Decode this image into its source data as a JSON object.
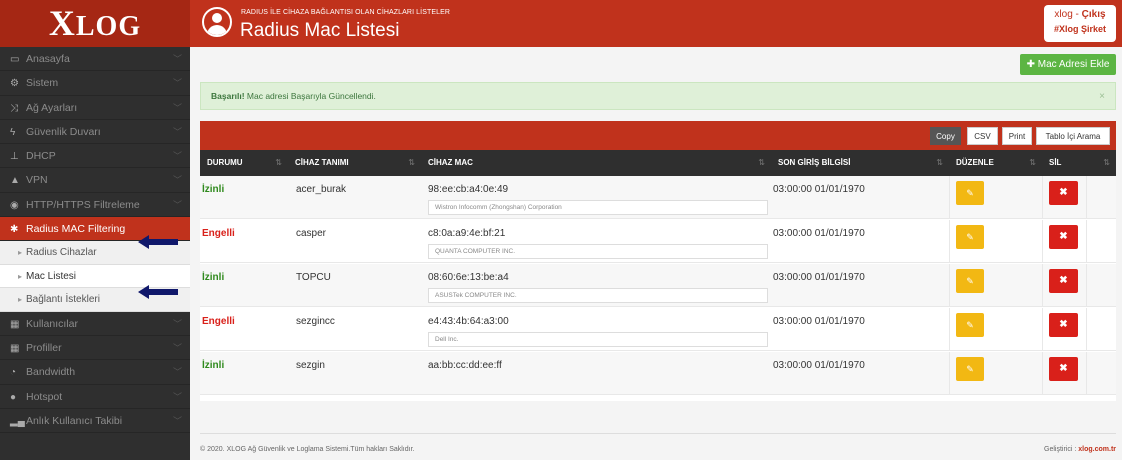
{
  "header": {
    "logo_x": "X",
    "logo_rest": "LOG",
    "subtitle": "RADIUS İLE CİHAZA BAĞLANTISI OLAN CİHAZLARI LİSTELER",
    "title": "Radius Mac Listesi",
    "user_name": "xlog - ",
    "logout_label": "Çıkış",
    "company": "#Xlog Şirket",
    "accent_color": "#c0321c"
  },
  "sidebar": {
    "items": [
      {
        "icon": "laptop-icon",
        "label": "Anasayfa"
      },
      {
        "icon": "cogs-icon",
        "label": "Sistem"
      },
      {
        "icon": "random-icon",
        "label": "Ağ Ayarları"
      },
      {
        "icon": "bolt-icon",
        "label": "Güvenlik Duvarı"
      },
      {
        "icon": "sitemap-icon",
        "label": "DHCP"
      },
      {
        "icon": "vpn-icon",
        "label": "VPN"
      },
      {
        "icon": "eye-slash-icon",
        "label": "HTTP/HTTPS Filtreleme"
      },
      {
        "icon": "asterisk-icon",
        "label": "Radius MAC Filtering"
      }
    ],
    "sub_items": [
      {
        "label": "Radius Cihazlar"
      },
      {
        "label": "Mac Listesi"
      },
      {
        "label": "Bağlantı İstekleri"
      }
    ],
    "items_after": [
      {
        "icon": "table-icon",
        "label": "Kullanıcılar"
      },
      {
        "icon": "table-icon",
        "label": "Profiller"
      },
      {
        "icon": "tachometer-icon",
        "label": "Bandwidth"
      },
      {
        "icon": "globe-icon",
        "label": "Hotspot"
      },
      {
        "icon": "signal-icon",
        "label": "Anlık Kullanıcı Takibi"
      }
    ]
  },
  "main": {
    "add_button": "Mac Adresi Ekle",
    "alert_strong": "Başarılı!",
    "alert_text": " Mac adresi Başarıyla Güncellendi.",
    "alert_close": "×",
    "toolbar": {
      "copy": "Copy",
      "csv": "CSV",
      "print": "Print",
      "search": "Tablo İçi Arama"
    },
    "columns": [
      "DURUMU",
      "CİHAZ TANIMI",
      "CİHAZ MAC",
      "SON GİRİŞ BİLGİSİ",
      "DÜZENLE",
      "SİL"
    ],
    "rows": [
      {
        "status": "İzinli",
        "allowed": true,
        "name": "acer_burak",
        "mac": "98:ee:cb:a4:0e:49",
        "vendor": "Wistron Infocomm (Zhongshan) Corporation",
        "last_login": "03:00:00 01/01/1970"
      },
      {
        "status": "Engelli",
        "allowed": false,
        "name": "casper",
        "mac": "c8:0a:a9:4e:bf:21",
        "vendor": "QUANTA COMPUTER INC.",
        "last_login": "03:00:00 01/01/1970"
      },
      {
        "status": "İzinli",
        "allowed": true,
        "name": "TOPCU",
        "mac": "08:60:6e:13:be:a4",
        "vendor": "ASUSTek COMPUTER INC.",
        "last_login": "03:00:00 01/01/1970"
      },
      {
        "status": "Engelli",
        "allowed": false,
        "name": "sezgincc",
        "mac": "e4:43:4b:64:a3:00",
        "vendor": "Dell Inc.",
        "last_login": "03:00:00 01/01/1970"
      },
      {
        "status": "İzinli",
        "allowed": true,
        "name": "sezgin",
        "mac": "aa:bb:cc:dd:ee:ff",
        "vendor": "",
        "last_login": "03:00:00 01/01/1970"
      }
    ]
  },
  "footer": {
    "copyright": "© 2020. XLOG Ağ Güvenlik ve Loglama Sistemi.Tüm hakları Saklıdır.",
    "dev_label": "Geliştirici : ",
    "dev_link": "xlog.com.tr"
  }
}
